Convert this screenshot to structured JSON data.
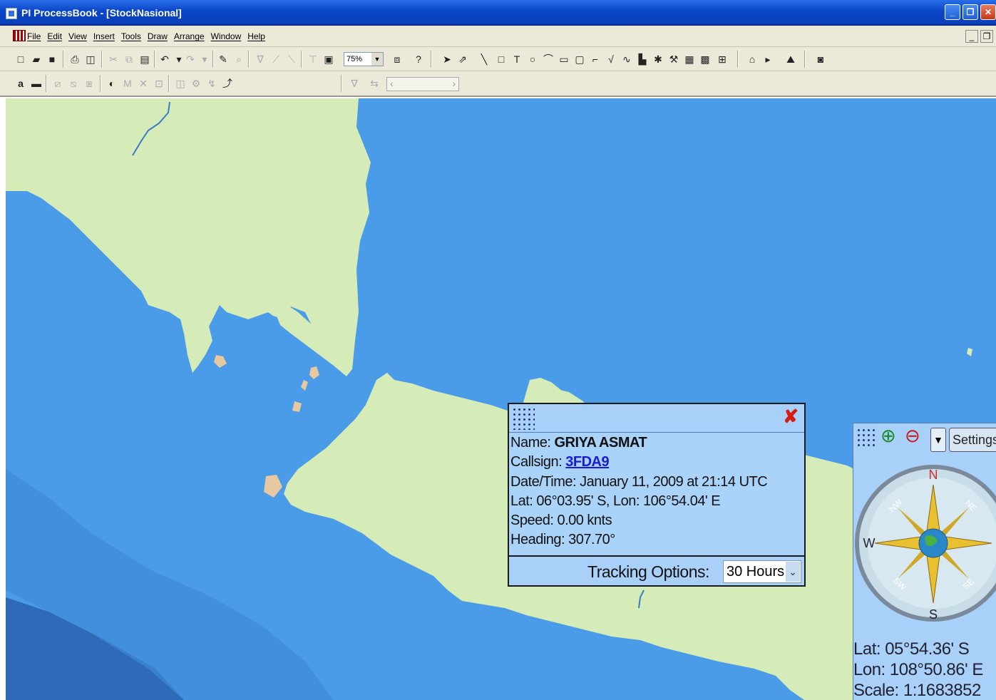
{
  "window": {
    "title": "PI ProcessBook - [StockNasional]"
  },
  "menubar": {
    "items": [
      "File",
      "Edit",
      "View",
      "Insert",
      "Tools",
      "Draw",
      "Arrange",
      "Window",
      "Help"
    ]
  },
  "toolbar": {
    "zoom_value": "75%"
  },
  "popup": {
    "name_label": "Name:",
    "name_value": "GRIYA ASMAT",
    "callsign_label": "Callsign:",
    "callsign_value": "3FDA9",
    "datetime": "Date/Time: January 11, 2009 at 21:14 UTC",
    "latlon": "Lat: 06°03.95' S, Lon: 106°54.04' E",
    "speed": "Speed: 0.00 knts",
    "heading": "Heading: 307.70°",
    "tracking_label": "Tracking Options:",
    "tracking_value": "30 Hours"
  },
  "compass": {
    "settings_label": "Settings",
    "dir_n": "N",
    "dir_s": "S",
    "dir_w": "W",
    "dir_ne": "NE",
    "dir_nw": "NW",
    "dir_se": "SE",
    "dir_sw": "SW",
    "lat": "Lat: 05°54.36' S",
    "lon": "Lon: 108°50.86' E",
    "scale": "Scale: 1:1683852"
  },
  "colors": {
    "sea": "#4a9be8",
    "deep_sea": "#2e6ab8",
    "land": "#d6ecb8",
    "shallow": "#5aa8ea",
    "popup": "#a8d0f8"
  }
}
